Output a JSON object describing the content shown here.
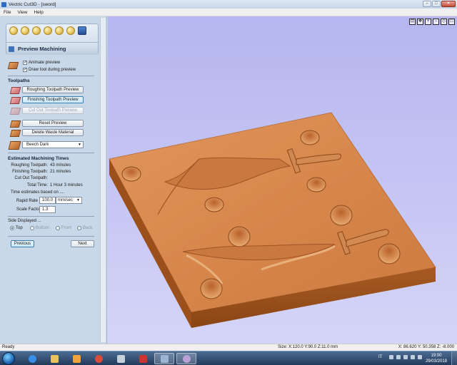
{
  "window": {
    "title": "Vectric Cut3D - [sword]",
    "minimize": "–",
    "maximize": "□",
    "close": "✕"
  },
  "menu": [
    "File",
    "View",
    "Help"
  ],
  "panel": {
    "section_title": "Preview Machining",
    "animate_preview": {
      "label": "Animate preview",
      "checked": true
    },
    "draw_tool": {
      "label": "Draw tool during preview",
      "checked": true
    },
    "toolpaths_title": "Toolpaths",
    "roughing_button": "Roughing Toolpath Preview",
    "finishing_button": "Finishing Toolpath Preview",
    "cutout_button": "Cut Out Toolpath Preview",
    "reset_button": "Reset Preview",
    "delete_waste_button": "Delete Waste Material",
    "material_select": "Beech Dark",
    "times_title": "Estimated Machining Times",
    "times": [
      {
        "label": "Roughing Toolpath:",
        "value": "43 minutes"
      },
      {
        "label": "Finishing Toolpath:",
        "value": "21 minutes"
      },
      {
        "label": "Cut Out Toolpath:",
        "value": ""
      },
      {
        "label": "Total Time:",
        "value": "1 Hour 3 minutes"
      }
    ],
    "estimates_note": "Time estimates based on ....",
    "rapid_rate_label": "Rapid Rate",
    "rapid_rate_value": "100.0",
    "rapid_rate_unit": "mm/sec",
    "scale_factor_label": "Scale Factor",
    "scale_factor_value": "1.3",
    "side_title": "Side Displayed ...",
    "sides": [
      {
        "label": "Top",
        "selected": true
      },
      {
        "label": "Bottom",
        "selected": false
      },
      {
        "label": "Front",
        "selected": false
      },
      {
        "label": "Back",
        "selected": false
      }
    ],
    "previous_button": "Previous",
    "next_button": "Next"
  },
  "view_tools": [
    "zoom-extents-icon",
    "pan-icon",
    "zoom-in-icon",
    "zoom-out-icon",
    "iso-view-icon",
    "top-view-icon"
  ],
  "status": {
    "left": "Ready",
    "size": "Size: X:120.0 Y:90.0 Z:11.0 mm",
    "coords": "X: 86.620 Y: 50.358 Z: -8.000"
  },
  "taskbar": {
    "apps": [
      {
        "name": "ie-icon",
        "color": "#3a8ee6",
        "open": false
      },
      {
        "name": "explorer-icon",
        "color": "#e8c25a",
        "open": false
      },
      {
        "name": "media-player-icon",
        "color": "#f2a23b",
        "open": false
      },
      {
        "name": "chrome-icon",
        "color": "#dd4b39",
        "open": false
      },
      {
        "name": "paint-icon",
        "color": "#c7d0da",
        "open": false
      },
      {
        "name": "cube-app-icon",
        "color": "#cc3333",
        "open": false
      },
      {
        "name": "cut3d-icon",
        "color": "#9db5d4",
        "open": true
      },
      {
        "name": "palette-icon",
        "color": "#b9a1d8",
        "open": true
      }
    ],
    "language": "IT",
    "time": "19:00",
    "date": "29/03/2018"
  },
  "colors": {
    "wood_top": "#d9844a",
    "wood_side": "#a9571f",
    "wood_front": "#8a4214",
    "viewport_bg": "#c4c4f4"
  }
}
